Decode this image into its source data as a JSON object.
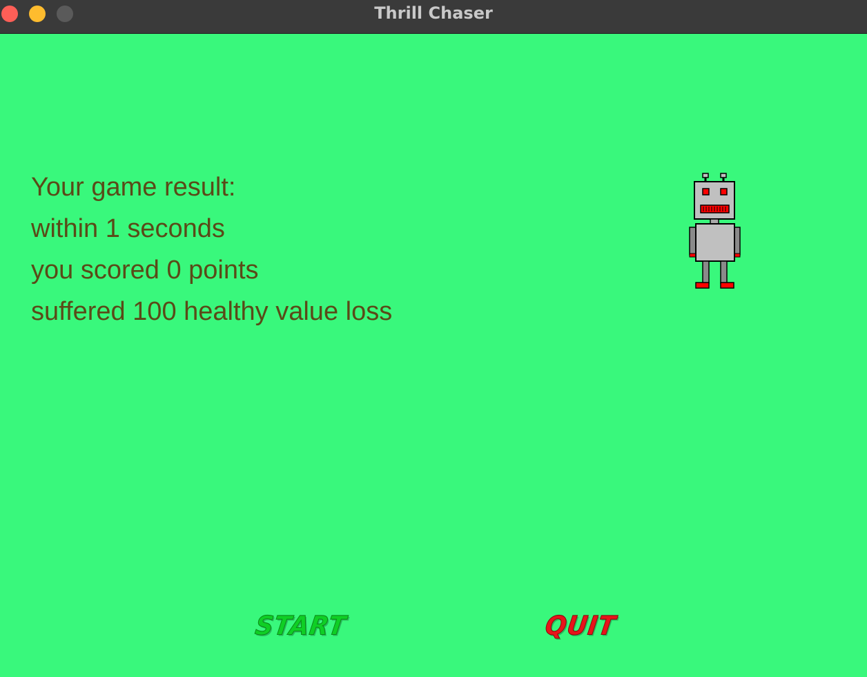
{
  "window": {
    "title": "Thrill Chaser"
  },
  "result": {
    "heading": "Your game result:",
    "time_line": "within 1 seconds",
    "score_line": "you scored 0 points",
    "health_line": "suffered 100 healthy value loss"
  },
  "buttons": {
    "start_label": "START",
    "quit_label": "QUIT"
  },
  "colors": {
    "background": "#39f87c",
    "result_text": "#5a4a18",
    "start_button": "#0fcf25",
    "quit_button": "#e8141a",
    "robot_body": "#c0c0c0",
    "robot_accent": "#ff0000"
  },
  "icons": {
    "character": "robot-icon"
  }
}
